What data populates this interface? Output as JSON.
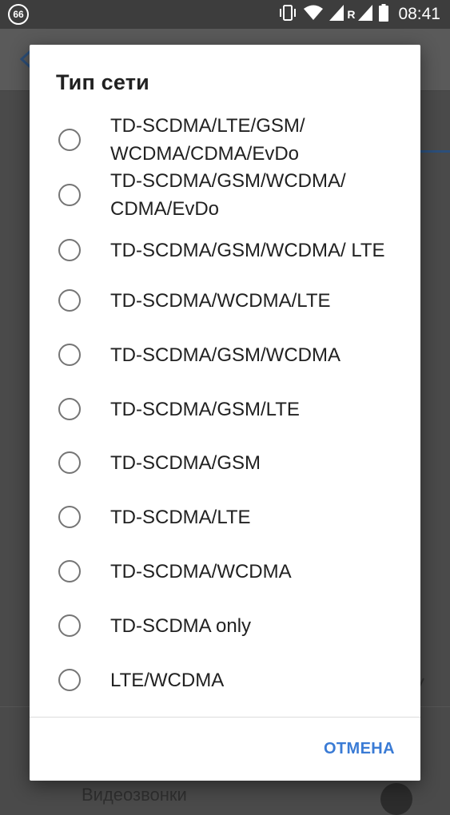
{
  "status_bar": {
    "badge": "66",
    "roaming_label": "R",
    "time": "08:41"
  },
  "background": {
    "bottom_label": "Видеозвонки"
  },
  "dialog": {
    "title": "Тип сети",
    "options": [
      "TD-SCDMA/LTE/GSM/ WCDMA/CDMA/EvDo",
      "TD-SCDMA/GSM/WCDMA/ CDMA/EvDo",
      "TD-SCDMA/GSM/WCDMA/ LTE",
      "TD-SCDMA/WCDMA/LTE",
      "TD-SCDMA/GSM/WCDMA",
      "TD-SCDMA/GSM/LTE",
      "TD-SCDMA/GSM",
      "TD-SCDMA/LTE",
      "TD-SCDMA/WCDMA",
      "TD-SCDMA only",
      "LTE/WCDMA"
    ],
    "cancel_label": "ОТМЕНА"
  },
  "colors": {
    "accent": "#3a7bd5",
    "radio_border": "#757575",
    "scrim": "#4a4a4a"
  }
}
